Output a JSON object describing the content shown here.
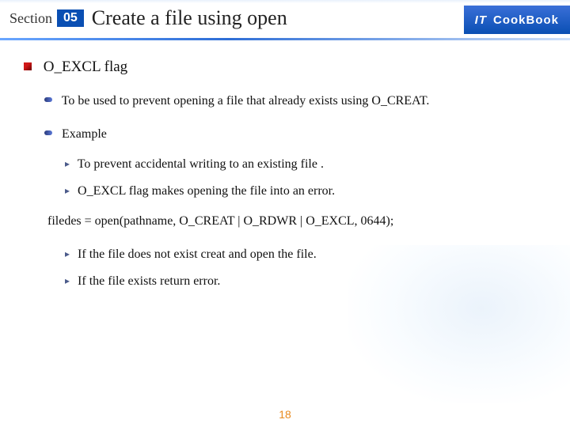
{
  "header": {
    "section_label": "Section",
    "section_num": "05",
    "title": "Create a file using open",
    "brand_it": "IT",
    "brand_book": "CookBook"
  },
  "content": {
    "heading": "O_EXCL flag",
    "desc": "To be used to prevent  opening a file that already exists using O_CREAT.",
    "example_label": "Example",
    "ex1": "To prevent accidental  writing to an existing file .",
    "ex2": "O_EXCL flag makes opening the file into an error.",
    "code": "filedes = open(pathname, O_CREAT | O_RDWR | O_EXCL, 0644);",
    "r1": "If the file does not exist creat and open the file.",
    "r2": "If the file exists return error."
  },
  "page": "18"
}
